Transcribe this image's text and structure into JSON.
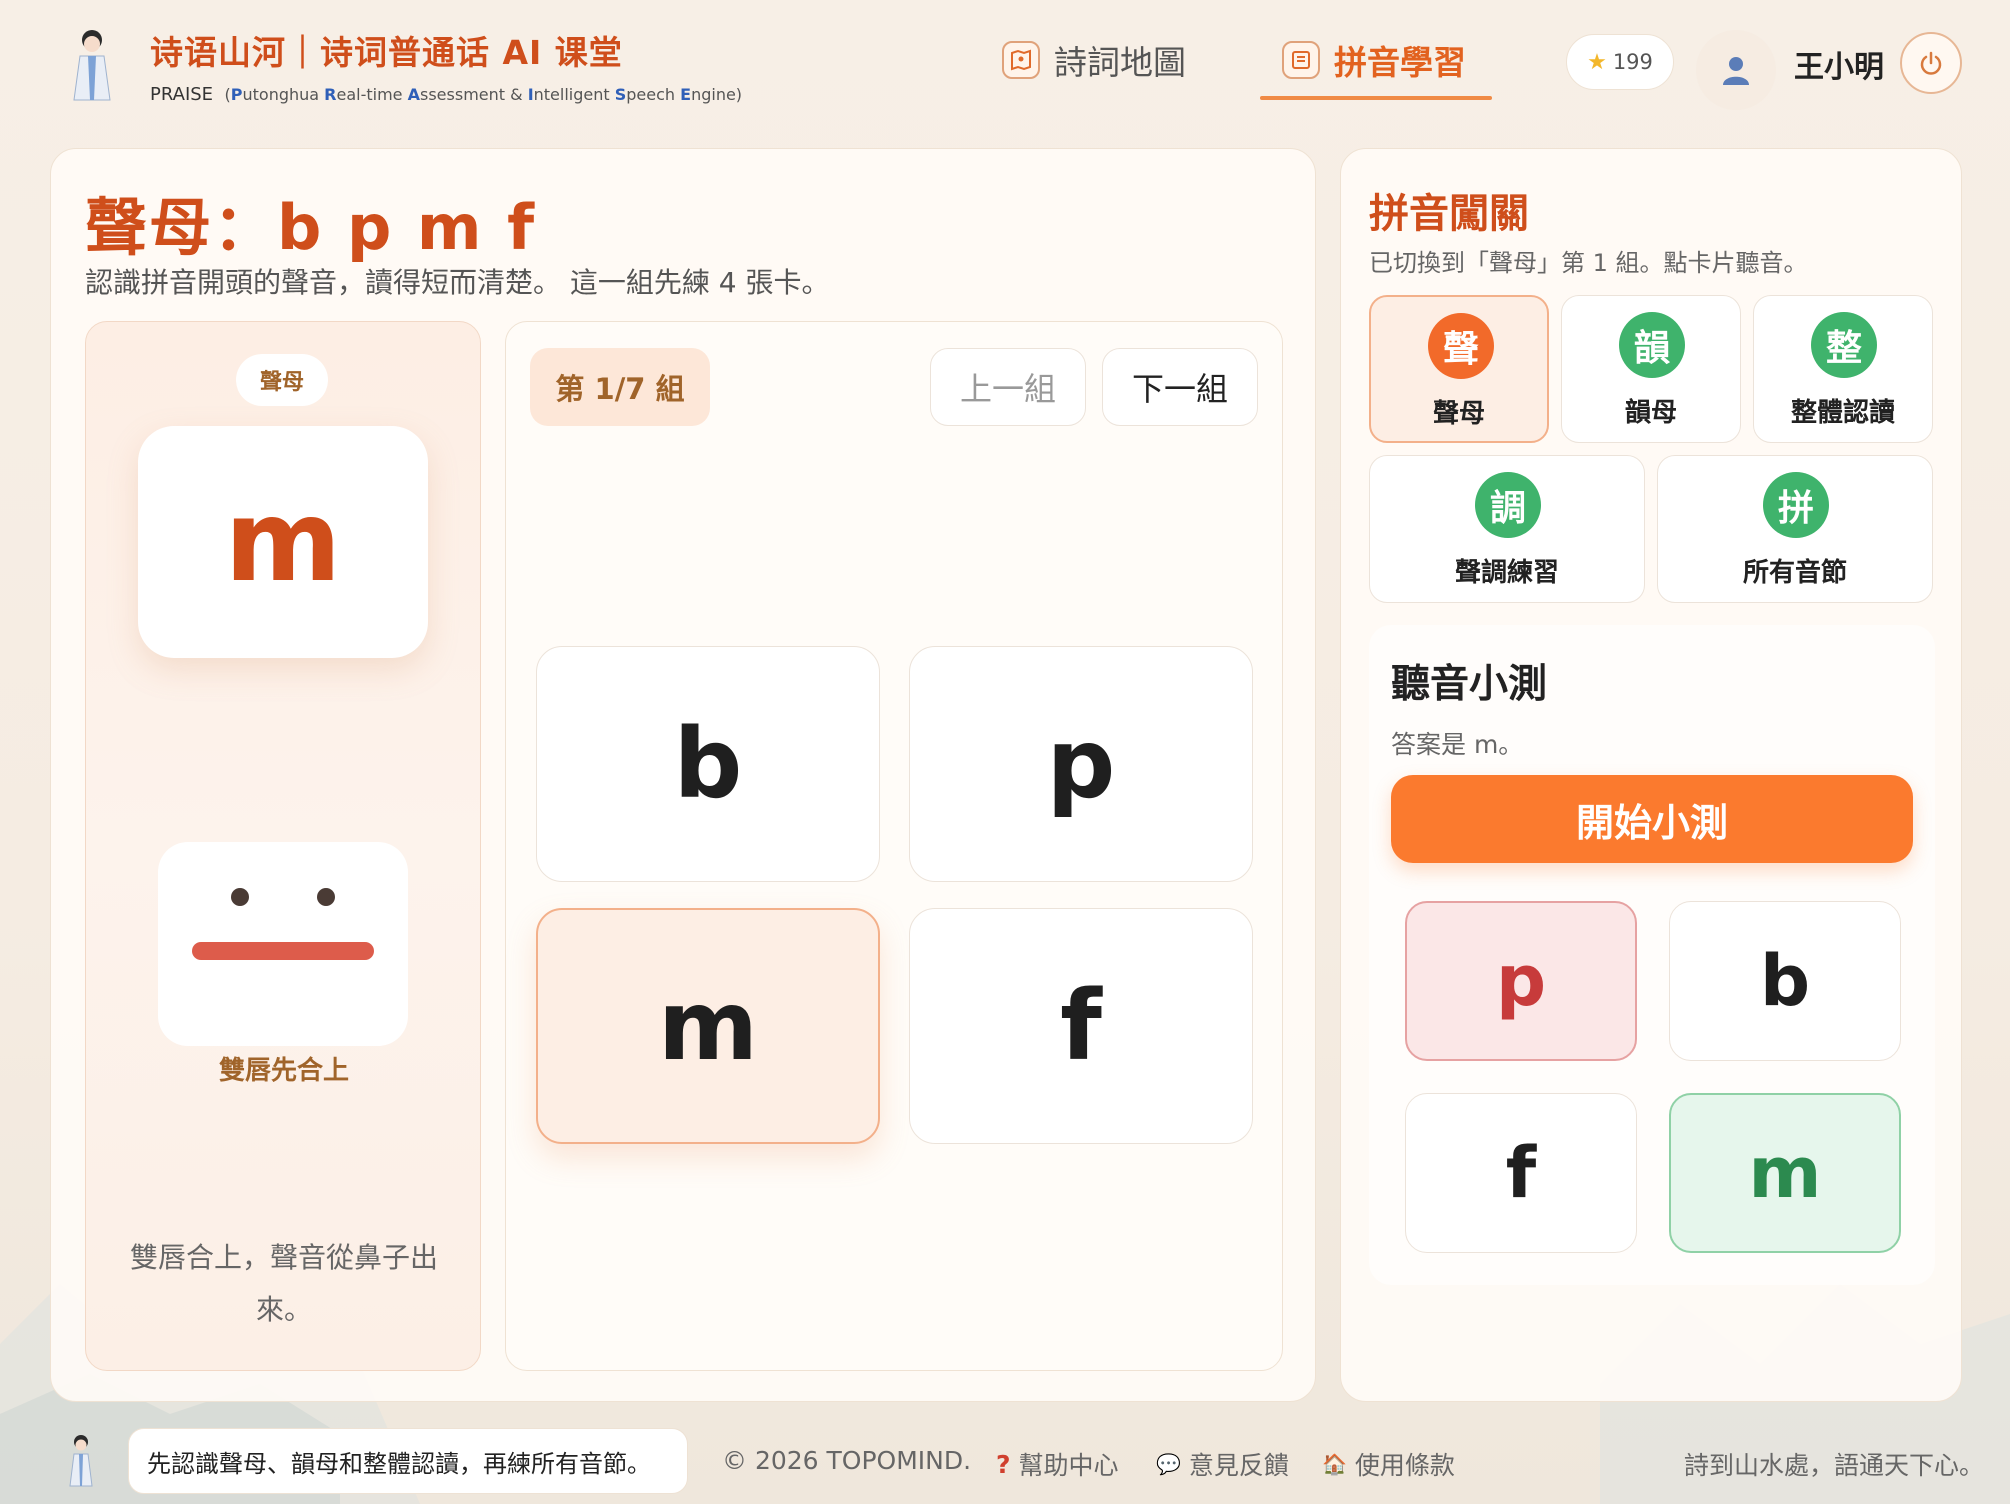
{
  "header": {
    "brand_title": "诗语山河｜诗词普通话 AI 课堂",
    "brand_name": "PRAISE",
    "brand_sub_open": "(",
    "brand_sub_p": "P",
    "brand_sub_1": "utonghua ",
    "brand_sub_r": "R",
    "brand_sub_2": "eal-time ",
    "brand_sub_a": "A",
    "brand_sub_3": "ssessment & ",
    "brand_sub_i": "I",
    "brand_sub_4": "ntelligent ",
    "brand_sub_s": "S",
    "brand_sub_5": "peech ",
    "brand_sub_e": "E",
    "brand_sub_6": "ngine)",
    "nav": [
      {
        "label": "詩詞地圖",
        "icon": "map-icon"
      },
      {
        "label": "拼音學習",
        "icon": "book-icon",
        "active": true
      }
    ],
    "stars": "199",
    "username": "王小明"
  },
  "main": {
    "title": "聲母：b p m f",
    "desc": "認識拼音開頭的聲音，讀得短而清楚。 這一組先練 4 張卡。",
    "detail": {
      "tag": "聲母",
      "letter": "m",
      "mouth_label": "雙唇先合上",
      "note": "雙唇合上，聲音從鼻子出來。"
    },
    "group_badge": "第 1/7 組",
    "prev_label": "上一組",
    "next_label": "下一組",
    "cards": [
      "b",
      "p",
      "m",
      "f"
    ],
    "active_card": "m"
  },
  "side": {
    "title": "拼音闖關",
    "desc": "已切換到「聲母」第 1 組。點卡片聽音。",
    "modes": [
      {
        "char": "聲",
        "label": "聲母",
        "color": "#f26a2a",
        "active": true
      },
      {
        "char": "韻",
        "label": "韻母",
        "color": "#3fb36c"
      },
      {
        "char": "整",
        "label": "整體認讀",
        "color": "#3fb36c"
      },
      {
        "char": "調",
        "label": "聲調練習",
        "color": "#3fb36c"
      },
      {
        "char": "拼",
        "label": "所有音節",
        "color": "#3fb36c"
      }
    ],
    "quiz": {
      "title": "聽音小測",
      "answer": "答案是 m。",
      "start_label": "開始小測",
      "options": [
        "p",
        "b",
        "f",
        "m"
      ]
    }
  },
  "footer": {
    "tip": "先認識聲母、韻母和整體認讀，再練所有音節。",
    "copyright": "© 2026 TOPOMIND.",
    "help": "幫助中心",
    "feedback": "意見反饋",
    "terms": "使用條款",
    "slogan": "詩到山水處，語通天下心。"
  },
  "colors": {
    "accent": "#cf4e1b",
    "orange": "#fb7a2e",
    "green": "#3fb36c",
    "wrong": "#c73b3b"
  }
}
